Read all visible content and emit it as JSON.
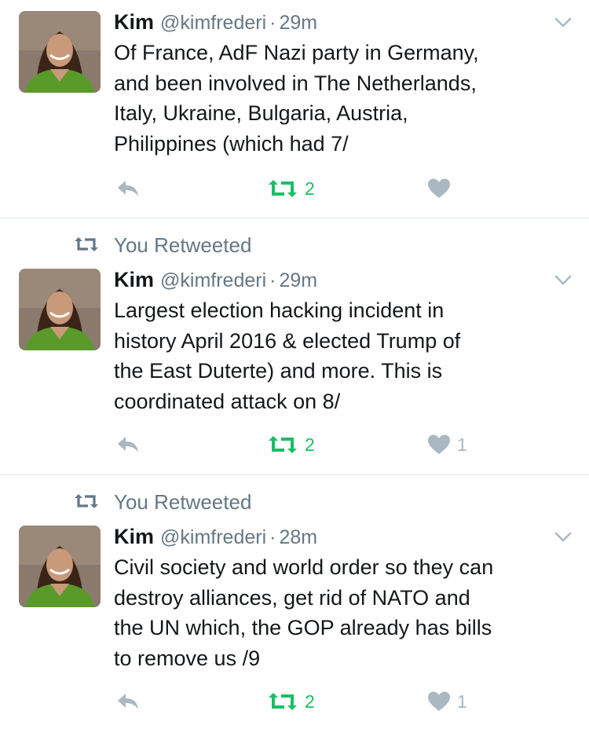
{
  "colors": {
    "text": "#14171a",
    "muted": "#657786",
    "icon_gray": "#aab8c2",
    "retweet_green": "#17bf63",
    "divider": "#e1e8ed"
  },
  "tweets": [
    {
      "retweeted_label": "",
      "name": "Kim",
      "handle": "@kimfrederi",
      "dot": "·",
      "time": "29m",
      "text": "Of France, AdF Nazi party in Germany,\nand been involved in The Netherlands,\nItaly, Ukraine, Bulgaria, Austria,\nPhilippines (which had 7/",
      "retweet_count": "2",
      "like_count": "",
      "icons": {
        "reply": "reply-icon",
        "retweet": "retweet-icon",
        "like": "heart-icon",
        "more": "chevron-down-icon"
      }
    },
    {
      "retweeted_label": "You Retweeted",
      "name": "Kim",
      "handle": "@kimfrederi",
      "dot": "·",
      "time": "29m",
      "text": "Largest election hacking incident in\nhistory April 2016 & elected Trump of\nthe East Duterte) and more. This is\ncoordinated attack on 8/",
      "retweet_count": "2",
      "like_count": "1",
      "icons": {
        "reply": "reply-icon",
        "retweet": "retweet-icon",
        "like": "heart-icon",
        "more": "chevron-down-icon"
      }
    },
    {
      "retweeted_label": "You Retweeted",
      "name": "Kim",
      "handle": "@kimfrederi",
      "dot": "·",
      "time": "28m",
      "text": "Civil society and world order so they can\ndestroy alliances, get rid of NATO and\nthe UN which, the GOP already has bills\nto remove us  /9",
      "retweet_count": "2",
      "like_count": "1",
      "icons": {
        "reply": "reply-icon",
        "retweet": "retweet-icon",
        "like": "heart-icon",
        "more": "chevron-down-icon"
      }
    }
  ]
}
